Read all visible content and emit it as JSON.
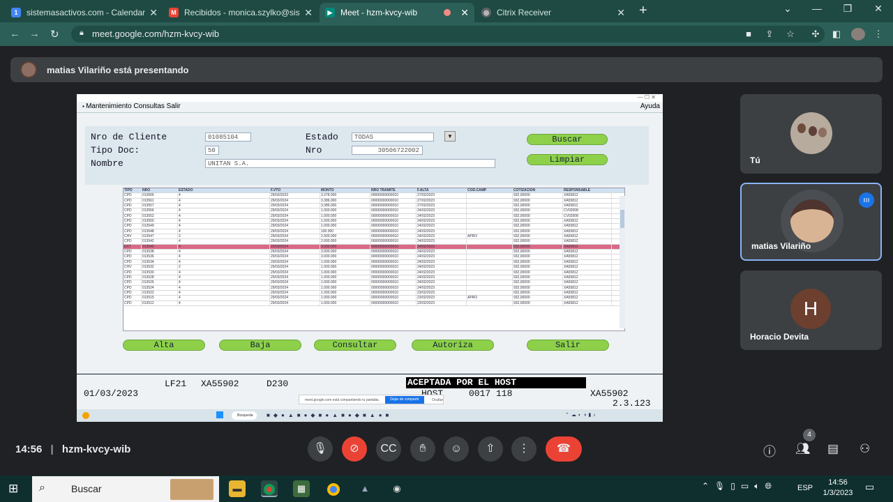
{
  "tabs": [
    {
      "title": "sistemasactivos.com - Calendar -",
      "icon": "calendar-icon",
      "color": "#4285f4",
      "glyph": "1"
    },
    {
      "title": "Recibidos - monica.szylko@sister",
      "icon": "gmail-icon",
      "color": "#ea4335",
      "glyph": "M"
    },
    {
      "title": "Meet - hzm-kvcy-wib",
      "icon": "meet-icon",
      "color": "#00897b",
      "glyph": "▶"
    },
    {
      "title": "Citrix Receiver",
      "icon": "citrix-icon",
      "color": "#5f6368",
      "glyph": "◎"
    }
  ],
  "browser": {
    "url": "meet.google.com/hzm-kvcy-wib"
  },
  "presenter": {
    "text": "matias Vilariño está presentando"
  },
  "app": {
    "menu": "Mantenimiento  Consultas  Salir",
    "help": "Ayuda",
    "labels": {
      "client": "Nro de Cliente",
      "doc_type": "Tipo Doc:",
      "name": "Nombre",
      "state": "Estado",
      "nro": "Nro"
    },
    "values": {
      "client": "01085104",
      "doc_type": "50",
      "name": "UNITAN S.A.",
      "state": "TODAS",
      "nro": "30506722002"
    },
    "buttons": {
      "search": "Buscar",
      "clear": "Limpiar",
      "add": "Alta",
      "delete": "Baja",
      "query": "Consultar",
      "authorize": "Autoriza",
      "exit": "Salir"
    },
    "columns": [
      "TIPO",
      "NRO",
      "ESTADO",
      "F.VTO",
      "MONTO",
      "NRO TRAMITE",
      "F.ALTA",
      "COD.CAMP",
      "COTIZACION",
      "RESPONSABLE"
    ],
    "rows": [
      [
        "CPD",
        "013566",
        "4",
        "29/03/2023",
        "3.378.000",
        "00000000000010",
        "27/02/2023",
        "",
        "932,00000",
        "XA55812"
      ],
      [
        "CPD",
        "013561",
        "4",
        "29/03/2024",
        "3.386.000",
        "00000000000010",
        "27/02/2023",
        "",
        "932,00000",
        "XA55812"
      ],
      [
        "CPD",
        "013557",
        "4",
        "29/03/2024",
        "3.386.000",
        "00000000000010",
        "27/02/2023",
        "",
        "932,00000",
        "XA55812"
      ],
      [
        "CPD",
        "013556",
        "4",
        "29/03/2024",
        "1.000.000",
        "00000000000010",
        "24/02/2023",
        "",
        "932,00000",
        "CV02008"
      ],
      [
        "CPD",
        "013552",
        "4",
        "29/03/2024",
        "1.000.000",
        "00000000000010",
        "24/02/2023",
        "",
        "932,00000",
        "CV02008"
      ],
      [
        "CPD",
        "013550",
        "4",
        "29/03/2024",
        "1.000.000",
        "00000000000010",
        "24/02/2023",
        "",
        "932,00000",
        "XA55812"
      ],
      [
        "CPD",
        "013549",
        "4",
        "29/03/2024",
        "1.000.000",
        "00000000000010",
        "24/02/2023",
        "",
        "932,00000",
        "XA55812"
      ],
      [
        "CPD",
        "013548",
        "4",
        "29/03/2024",
        "100.000",
        "00000000000010",
        "24/02/2023",
        "",
        "932,00000",
        "XA55812"
      ],
      [
        "CHV",
        "013547",
        "2",
        "29/03/2024",
        "2.000.000",
        "00000000000010",
        "24/02/2023",
        "APRO",
        "932,00000",
        "XA55812"
      ],
      [
        "CPD",
        "013542",
        "4",
        "29/03/2024",
        "2.000.000",
        "00000000000010",
        "24/02/2023",
        "",
        "932,00000",
        "XA55812"
      ],
      [
        "EXT",
        "013540",
        "4",
        "29/03/2024",
        "3.000.000",
        "00000000000010",
        "24/02/2023",
        "",
        "932,00000",
        "XA55812"
      ],
      [
        "CPD",
        "013538",
        "4",
        "29/03/2024",
        "3.000.000",
        "00000000000010",
        "24/02/2023",
        "",
        "932,00000",
        "XA55812"
      ],
      [
        "CPD",
        "013536",
        "4",
        "29/03/2024",
        "3.000.000",
        "00000000000010",
        "24/02/2023",
        "",
        "932,00000",
        "XA55812"
      ],
      [
        "CPD",
        "013534",
        "4",
        "29/03/2024",
        "1.000.000",
        "00000000000010",
        "24/02/2023",
        "",
        "932,00000",
        "XA55812"
      ],
      [
        "CHV",
        "013532",
        "2",
        "29/03/2024",
        "1.000.000",
        "00000000000010",
        "24/02/2023",
        "",
        "932,00000",
        "XA55812"
      ],
      [
        "CPD",
        "013530",
        "4",
        "29/03/2024",
        "1.000.000",
        "00000000000010",
        "24/02/2023",
        "",
        "932,00000",
        "XA55812"
      ],
      [
        "CPD",
        "013528",
        "4",
        "29/03/2024",
        "1.000.000",
        "00000000000010",
        "24/02/2023",
        "",
        "932,00000",
        "XA55812"
      ],
      [
        "CPD",
        "013526",
        "4",
        "29/03/2024",
        "1.000.000",
        "00000000000010",
        "24/02/2023",
        "",
        "932,00000",
        "XA55812"
      ],
      [
        "CPD",
        "013524",
        "4",
        "29/03/2024",
        "1.000.000",
        "00000000000010",
        "24/02/2023",
        "",
        "932,00000",
        "XA55812"
      ],
      [
        "CPD",
        "013522",
        "4",
        "29/03/2024",
        "1.000.000",
        "00000000000010",
        "23/02/2023",
        "",
        "932,00000",
        "XA55812"
      ],
      [
        "CPD",
        "013515",
        "4",
        "29/03/2024",
        "1.000.000",
        "00000000000010",
        "23/02/2023",
        "APRO",
        "932,00000",
        "XA55812"
      ],
      [
        "CPD",
        "013512",
        "4",
        "29/03/2024",
        "1.000.000",
        "00000000000010",
        "23/02/2023",
        "",
        "932,00000",
        "XA55812"
      ]
    ],
    "status": {
      "line1a": "LF21",
      "line1b": "XA55902",
      "line1c": "D230",
      "accepted": "ACEPTADA POR EL HOST",
      "date": "01/03/2023",
      "host": "HOST",
      "host_num": "0017 118",
      "user": "XA55902",
      "version": "2.3.123"
    },
    "share_note": "meet.google.com está compartiendo tu pantalla.",
    "share_btn": "Dejar de compartir",
    "share_hide": "Ocultar",
    "remote_search": "Búsqueda"
  },
  "participants": [
    {
      "name": "Tú"
    },
    {
      "name": "matias Vilariño"
    },
    {
      "name": "Horacio Devita",
      "initial": "H"
    }
  ],
  "meet": {
    "time": "14:56",
    "code": "hzm-kvcy-wib",
    "participant_count": "4"
  },
  "taskbar": {
    "search": "Buscar",
    "time": "14:56",
    "date": "1/3/2023",
    "lang": "ESP"
  },
  "colors": {
    "tabbar": "#1e4a43",
    "end_call": "#ea4335",
    "grid_selected": "#d86a86",
    "button_green": "#8fd04a"
  }
}
